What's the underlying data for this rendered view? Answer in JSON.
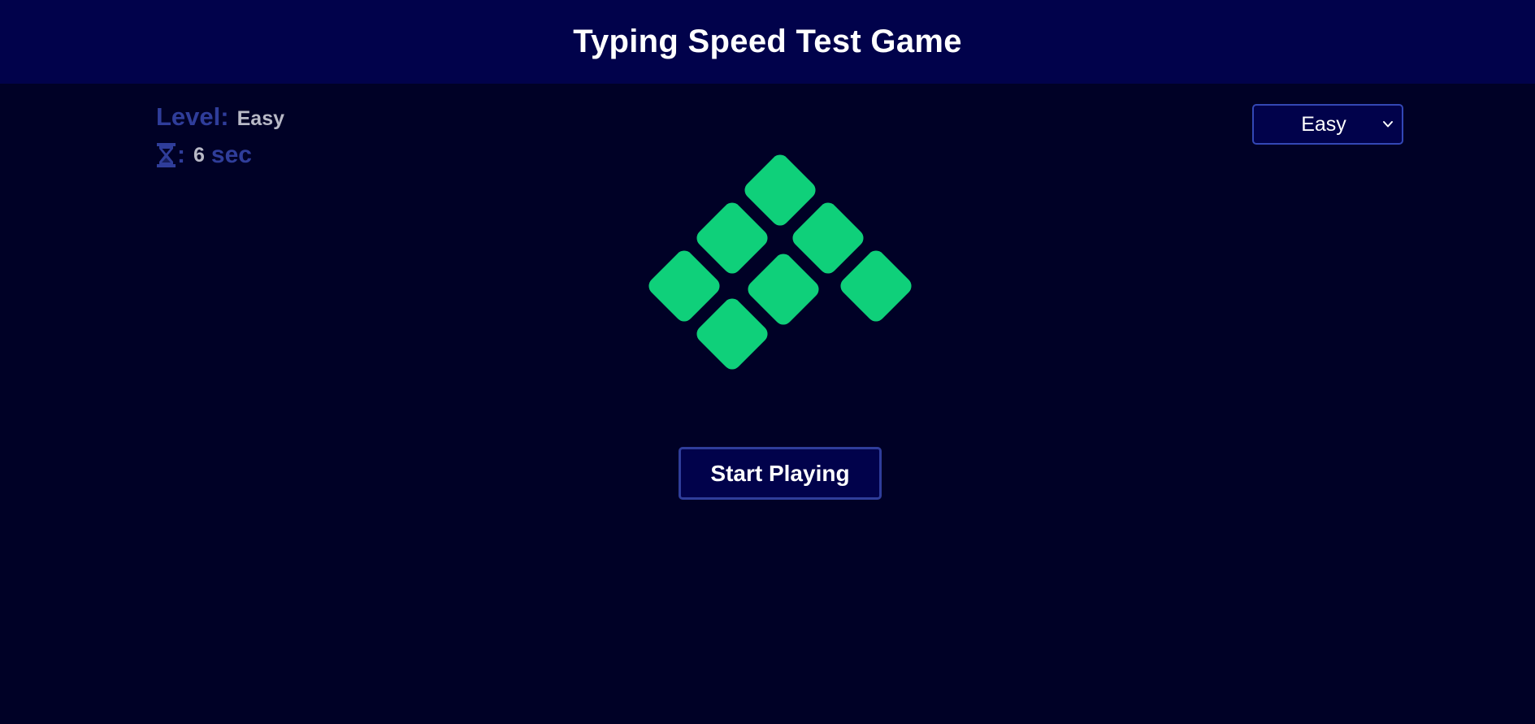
{
  "header": {
    "title": "Typing Speed Test Game"
  },
  "status": {
    "level_label": "Level:",
    "level_value": "Easy",
    "time_colon": ":",
    "time_value": "6",
    "time_unit": "sec",
    "timer_icon": "hourglass-icon"
  },
  "difficulty_select": {
    "selected": "Easy",
    "icon": "chevron-down-icon"
  },
  "logo": {
    "icon": "diamond-grid-logo",
    "gradient_start": "#0fd07a",
    "gradient_end": "#3d5fd3"
  },
  "start_button": {
    "label": "Start Playing"
  },
  "colors": {
    "background": "#000126",
    "header_bg": "#01024b",
    "accent": "#2f3d9a",
    "value_text": "#b8b9c6"
  }
}
